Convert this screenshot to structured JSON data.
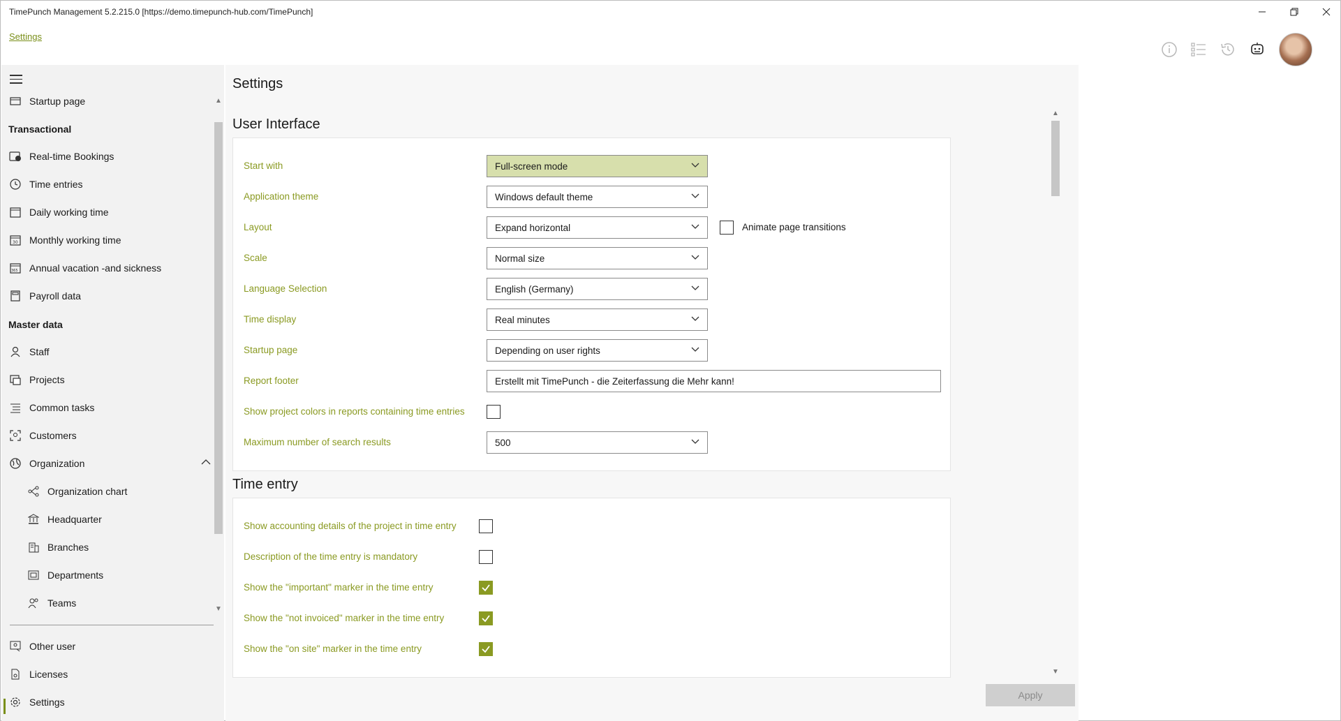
{
  "window": {
    "title": "TimePunch Management 5.2.215.0 [https://demo.timepunch-hub.com/TimePunch]"
  },
  "header": {
    "breadcrumb": "Settings",
    "icons": [
      "info-icon",
      "list-icon",
      "history-icon",
      "chat-bot-icon",
      "user-avatar"
    ]
  },
  "sidebar": {
    "top_item": "Startup page",
    "sections": [
      {
        "title": "Transactional",
        "items": [
          {
            "label": "Real-time Bookings",
            "icon": "realtime-bookings-icon"
          },
          {
            "label": "Time entries",
            "icon": "clock-icon"
          },
          {
            "label": "Daily working time",
            "icon": "calendar-day-icon"
          },
          {
            "label": "Monthly working time",
            "icon": "calendar-month-icon"
          },
          {
            "label": "Annual vacation -and sickness",
            "icon": "calendar-year-icon"
          },
          {
            "label": "Payroll data",
            "icon": "calculator-icon"
          }
        ]
      },
      {
        "title": "Master data",
        "items": [
          {
            "label": "Staff",
            "icon": "person-icon"
          },
          {
            "label": "Projects",
            "icon": "projects-icon"
          },
          {
            "label": "Common tasks",
            "icon": "tasks-list-icon"
          },
          {
            "label": "Customers",
            "icon": "customers-icon"
          },
          {
            "label": "Organization",
            "icon": "globe-icon"
          }
        ]
      }
    ],
    "organization_children": [
      {
        "label": "Organization chart",
        "icon": "org-chart-icon"
      },
      {
        "label": "Headquarter",
        "icon": "bank-icon"
      },
      {
        "label": "Branches",
        "icon": "building-icon"
      },
      {
        "label": "Departments",
        "icon": "department-icon"
      },
      {
        "label": "Teams",
        "icon": "team-icon"
      }
    ],
    "bottom_items": [
      {
        "label": "Other user",
        "icon": "other-user-icon"
      },
      {
        "label": "Licenses",
        "icon": "license-icon"
      },
      {
        "label": "Settings",
        "icon": "gear-icon"
      }
    ]
  },
  "main": {
    "title": "Settings",
    "user_interface": {
      "title": "User Interface",
      "start_with": {
        "label": "Start with",
        "value": "Full-screen mode"
      },
      "theme": {
        "label": "Application theme",
        "value": "Windows default theme"
      },
      "layout": {
        "label": "Layout",
        "value": "Expand horizontal",
        "animate_label": "Animate page transitions",
        "animate_checked": false
      },
      "scale": {
        "label": "Scale",
        "value": "Normal size"
      },
      "language": {
        "label": "Language Selection",
        "value": "English (Germany)"
      },
      "time_display": {
        "label": "Time display",
        "value": "Real minutes"
      },
      "startup_page": {
        "label": "Startup page",
        "value": "Depending on user rights"
      },
      "report_footer": {
        "label": "Report footer",
        "value": "Erstellt mit TimePunch - die Zeiterfassung die Mehr kann!"
      },
      "project_colors": {
        "label": "Show project colors in reports containing time entries",
        "checked": false
      },
      "max_results": {
        "label": "Maximum number of search results",
        "value": "500"
      }
    },
    "time_entry": {
      "title": "Time entry",
      "options": [
        {
          "label": "Show accounting details of the project in time entry",
          "checked": false
        },
        {
          "label": "Description of the time entry is mandatory",
          "checked": false
        },
        {
          "label": "Show the \"important\" marker in the time entry",
          "checked": true
        },
        {
          "label": "Show the \"not invoiced\" marker in the time entry",
          "checked": true
        },
        {
          "label": "Show the \"on site\" marker in the time entry",
          "checked": true
        }
      ]
    },
    "apply_label": "Apply"
  },
  "colors": {
    "accent": "#8a9a22",
    "highlight_dropdown": "#d7dfac",
    "sidebar_bg": "#f2f2f2",
    "content_bg": "#f7f7f7"
  }
}
